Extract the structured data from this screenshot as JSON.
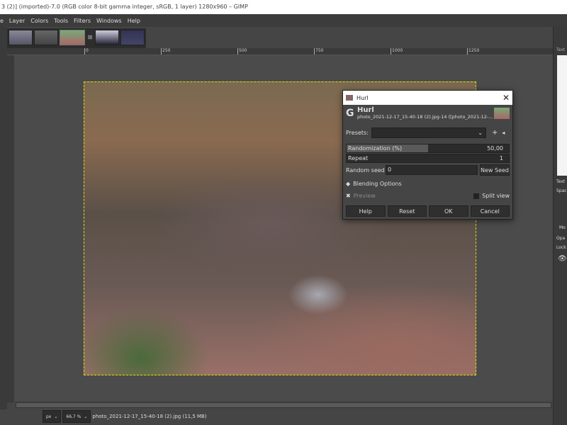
{
  "window": {
    "title": "3 (2)] (imported)-7.0 (RGB color 8-bit gamma integer, sRGB, 1 layer) 1280x960 – GIMP"
  },
  "menu": [
    "e",
    "Layer",
    "Colors",
    "Tools",
    "Filters",
    "Windows",
    "Help"
  ],
  "ruler": {
    "ticks": [
      "0",
      "250",
      "500",
      "750",
      "1000",
      "1250"
    ]
  },
  "status": {
    "unit": "px",
    "zoom": "66,7 %",
    "file": "photo_2021-12-17_15-40-18 (2).jpg (11,5 MB)"
  },
  "right_panel": {
    "labels": [
      "Text",
      "Text",
      "Spac",
      "Mo",
      "Opa",
      "Lock"
    ]
  },
  "dialog": {
    "window_title": "Hurl",
    "title": "Hurl",
    "subtitle": "photo_2021-12-17_15-40-18 (2).jpg-14 ([photo_2021-12-...",
    "presets_label": "Presets:",
    "presets_value": "",
    "randomization_label": "Randomization (%)",
    "randomization_value": "50,00",
    "randomization_fraction": 0.5,
    "repeat_label": "Repeat",
    "repeat_value": "1",
    "seed_label": "Random seed",
    "seed_value": "0",
    "new_seed": "New Seed",
    "blending": "Blending Options",
    "preview": "Preview",
    "preview_checked": true,
    "split_view": "Split view",
    "split_view_checked": false,
    "buttons": {
      "help": "Help",
      "reset": "Reset",
      "ok": "OK",
      "cancel": "Cancel"
    }
  }
}
